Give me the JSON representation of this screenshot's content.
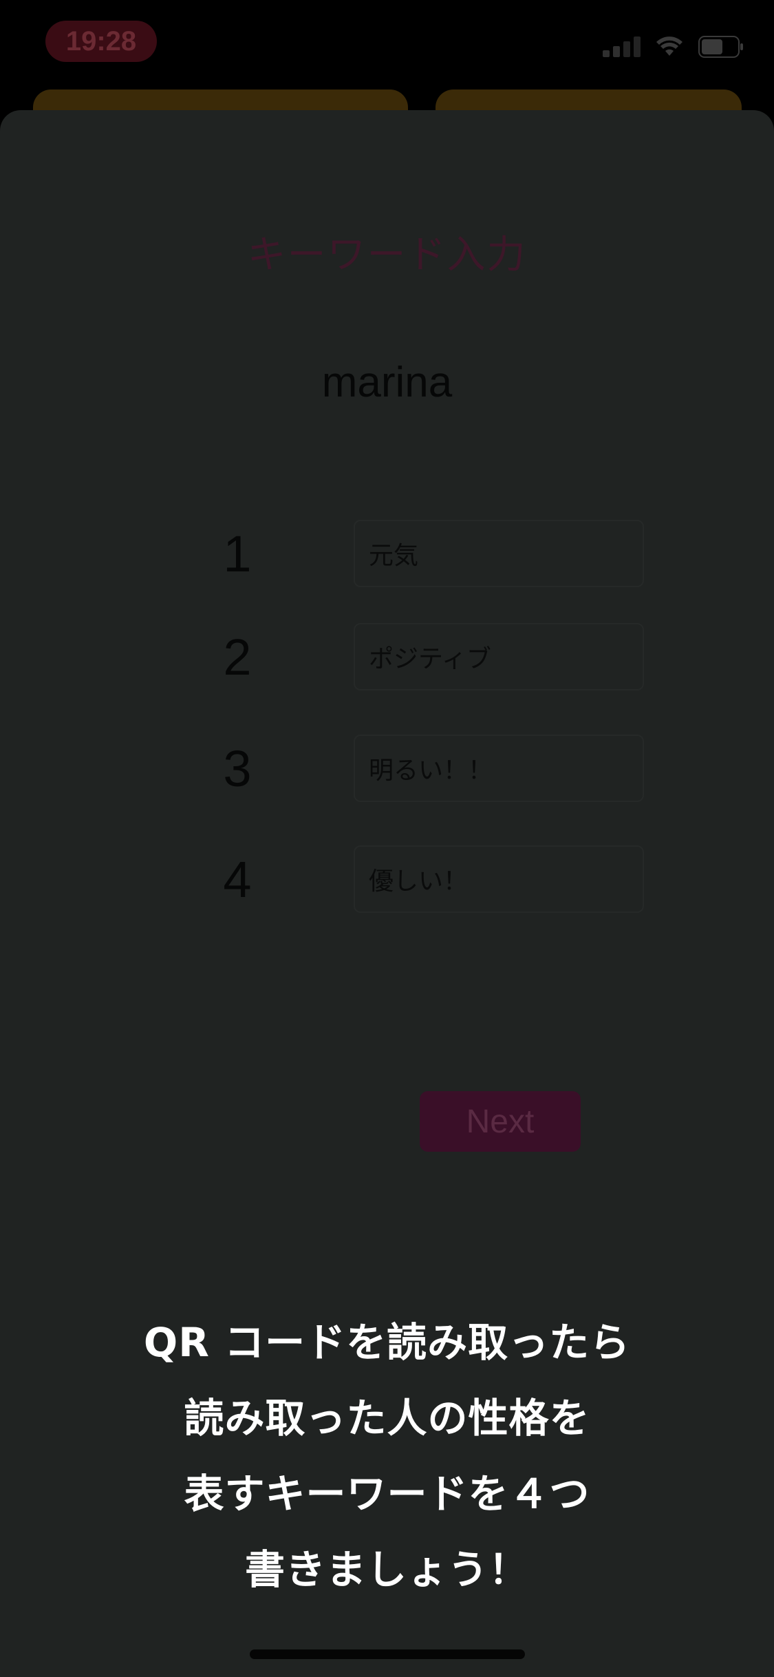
{
  "status_bar": {
    "time": "19:28"
  },
  "screen": {
    "title": "キーワード入力",
    "user_name": "marina"
  },
  "keywords": [
    {
      "number": "1",
      "value": "元気"
    },
    {
      "number": "2",
      "value": "ポジティブ"
    },
    {
      "number": "3",
      "value": "明るい！！"
    },
    {
      "number": "4",
      "value": "優しい！"
    }
  ],
  "next_button": {
    "label": "Next"
  },
  "instruction": {
    "lines": [
      "QR コードを読み取ったら",
      "読み取った人の性格を",
      "表すキーワードを４つ",
      "書きましょう！"
    ]
  },
  "colors": {
    "overlay": "#202322",
    "accent": "#3a0f28",
    "instruction_text": "#ffffff"
  }
}
